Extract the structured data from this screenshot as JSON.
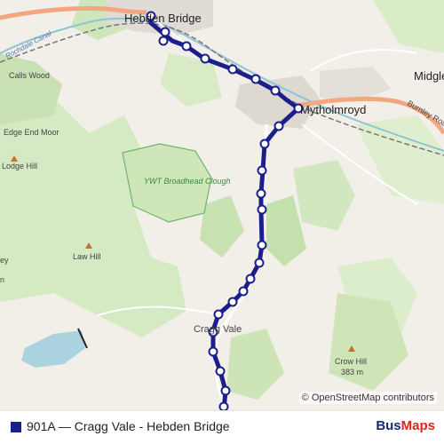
{
  "map": {
    "places": {
      "hebden_bridge": "Hebden Bridge",
      "mytholmroyd": "Mytholmroyd",
      "midgley": "Midgle",
      "cragg_vale": "Cragg Vale",
      "crow_hill": "Crow Hill",
      "crow_hill_elev": "383 m",
      "law_hill": "Law Hill",
      "lodge_hill": "Lodge Hill",
      "edge_end_moor": "Edge End Moor",
      "calls_wood": "Calls Wood",
      "ywt_broadhead_clough": "YWT Broadhead Clough",
      "rochdale_canal": "Rochdale Canal",
      "burnley_road": "Burnley Road",
      "edge_partial_1": "ey",
      "edge_partial_2": "n"
    },
    "route_color": "#1a1f8c",
    "road_color": "#f4a582",
    "green_color": "#d5e9c2",
    "water_color": "#aad3df",
    "attribution": "© OpenStreetMap contributors"
  },
  "legend": {
    "label": "901A — Cragg Vale - Hebden Bridge",
    "swatch_color": "#1a1f8c"
  },
  "brand": {
    "part1": "Bus",
    "part2": "Maps"
  }
}
